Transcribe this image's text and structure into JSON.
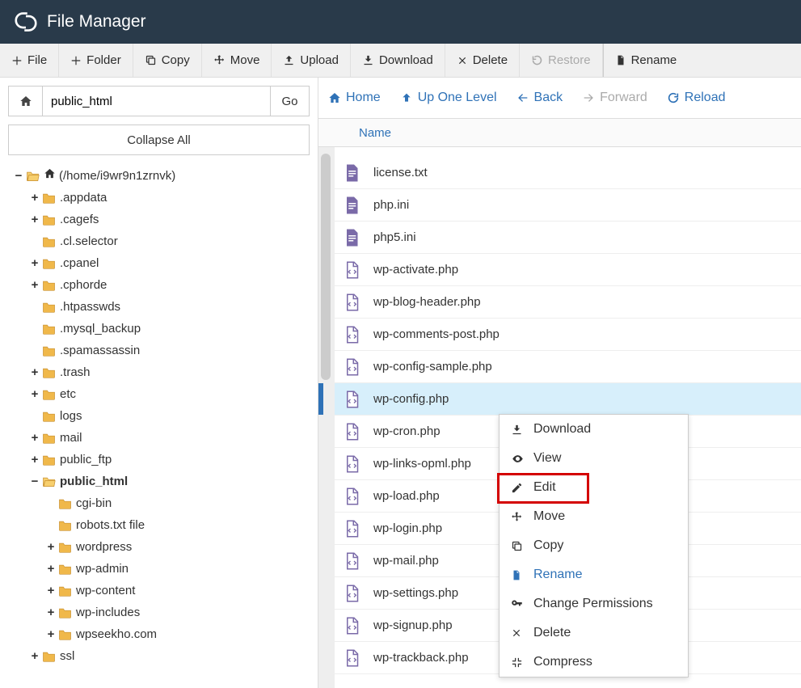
{
  "app": {
    "title": "File Manager"
  },
  "toolbar": [
    {
      "icon": "plus",
      "label": "File"
    },
    {
      "icon": "plus",
      "label": "Folder"
    },
    {
      "icon": "copy",
      "label": "Copy"
    },
    {
      "icon": "move",
      "label": "Move"
    },
    {
      "icon": "upload",
      "label": "Upload"
    },
    {
      "icon": "download",
      "label": "Download"
    },
    {
      "icon": "x",
      "label": "Delete"
    },
    {
      "icon": "restore",
      "label": "Restore",
      "disabled": true
    },
    {
      "icon": "rename",
      "label": "Rename"
    }
  ],
  "pathbar": {
    "value": "public_html",
    "go": "Go"
  },
  "collapse_all": "Collapse All",
  "tree": {
    "root_label": "(/home/i9wr9n1zrnvk)",
    "items": [
      {
        "toggle": "+",
        "label": ".appdata"
      },
      {
        "toggle": "+",
        "label": ".cagefs"
      },
      {
        "toggle": "",
        "label": ".cl.selector"
      },
      {
        "toggle": "+",
        "label": ".cpanel"
      },
      {
        "toggle": "+",
        "label": ".cphorde"
      },
      {
        "toggle": "",
        "label": ".htpasswds"
      },
      {
        "toggle": "",
        "label": ".mysql_backup"
      },
      {
        "toggle": "",
        "label": ".spamassassin"
      },
      {
        "toggle": "+",
        "label": ".trash"
      },
      {
        "toggle": "+",
        "label": "etc"
      },
      {
        "toggle": "",
        "label": "logs"
      },
      {
        "toggle": "+",
        "label": "mail"
      },
      {
        "toggle": "+",
        "label": "public_ftp"
      },
      {
        "toggle": "-",
        "label": "public_html",
        "bold": true,
        "open": true,
        "children": [
          {
            "toggle": "",
            "label": "cgi-bin"
          },
          {
            "toggle": "",
            "label": "robots.txt file"
          },
          {
            "toggle": "+",
            "label": "wordpress"
          },
          {
            "toggle": "+",
            "label": "wp-admin"
          },
          {
            "toggle": "+",
            "label": "wp-content"
          },
          {
            "toggle": "+",
            "label": "wp-includes"
          },
          {
            "toggle": "+",
            "label": "wpseekho.com"
          }
        ]
      },
      {
        "toggle": "+",
        "label": "ssl"
      }
    ]
  },
  "nav": {
    "home": "Home",
    "up": "Up One Level",
    "back": "Back",
    "forward": "Forward",
    "reload": "Reload"
  },
  "table": {
    "name_header": "Name"
  },
  "files": [
    {
      "icon": "doc",
      "name": "license.txt"
    },
    {
      "icon": "doc",
      "name": "php.ini"
    },
    {
      "icon": "doc",
      "name": "php5.ini"
    },
    {
      "icon": "code",
      "name": "wp-activate.php"
    },
    {
      "icon": "code",
      "name": "wp-blog-header.php"
    },
    {
      "icon": "code",
      "name": "wp-comments-post.php"
    },
    {
      "icon": "code",
      "name": "wp-config-sample.php"
    },
    {
      "icon": "code",
      "name": "wp-config.php",
      "selected": true
    },
    {
      "icon": "code",
      "name": "wp-cron.php"
    },
    {
      "icon": "code",
      "name": "wp-links-opml.php"
    },
    {
      "icon": "code",
      "name": "wp-load.php"
    },
    {
      "icon": "code",
      "name": "wp-login.php"
    },
    {
      "icon": "code",
      "name": "wp-mail.php"
    },
    {
      "icon": "code",
      "name": "wp-settings.php"
    },
    {
      "icon": "code",
      "name": "wp-signup.php"
    },
    {
      "icon": "code",
      "name": "wp-trackback.php"
    }
  ],
  "context_menu": [
    {
      "icon": "download",
      "label": "Download"
    },
    {
      "icon": "eye",
      "label": "View"
    },
    {
      "icon": "pencil",
      "label": "Edit"
    },
    {
      "icon": "move",
      "label": "Move"
    },
    {
      "icon": "copy",
      "label": "Copy"
    },
    {
      "icon": "rename",
      "label": "Rename",
      "cls": "rename"
    },
    {
      "icon": "key",
      "label": "Change Permissions"
    },
    {
      "icon": "x",
      "label": "Delete"
    },
    {
      "icon": "compress",
      "label": "Compress"
    }
  ]
}
